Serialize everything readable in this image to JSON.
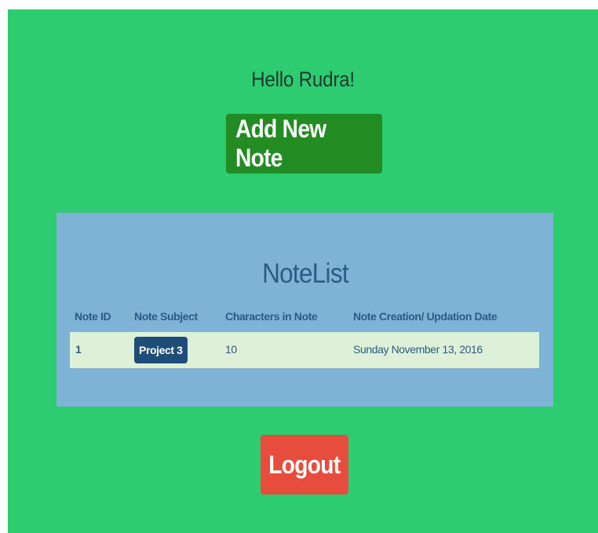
{
  "header": {
    "greeting": "Hello Rudra!",
    "add_note_label": "Add New Note"
  },
  "notelist": {
    "title": "NoteList",
    "columns": [
      "Note ID",
      "Note Subject",
      "Characters in Note",
      "Note Creation/ Updation Date"
    ],
    "rows": [
      {
        "id": "1",
        "subject": "Project 3",
        "characters": "10",
        "date": "Sunday November 13, 2016"
      }
    ]
  },
  "footer": {
    "logout_label": "Logout"
  },
  "colors": {
    "background": "#2ecc71",
    "add_button": "#228b22",
    "panel": "#7fb3d5",
    "row": "#dff0d8",
    "badge": "#1e4d78",
    "logout_button": "#e74c3c",
    "heading_text": "#2c5a86"
  }
}
